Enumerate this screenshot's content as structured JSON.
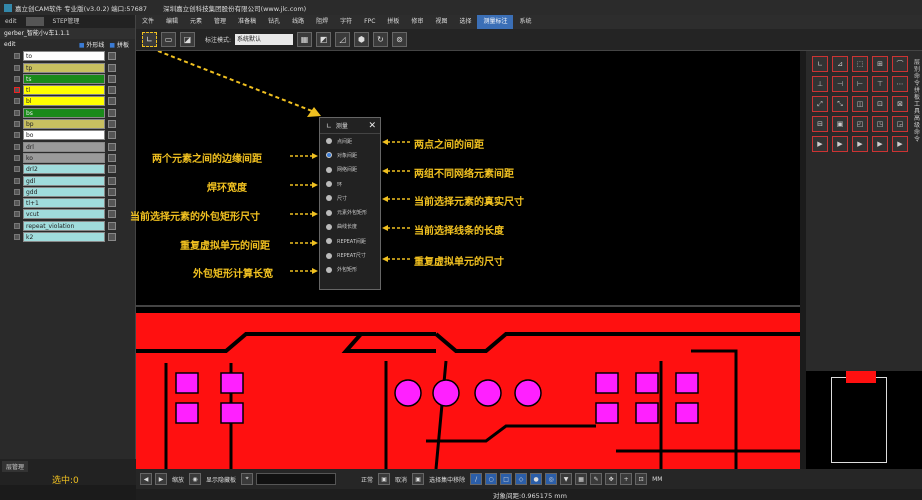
{
  "app": {
    "title": "嘉立创CAM软件 专业版(v3.0.2) 端口:57687",
    "company": "深圳嘉立创科技集团股份有限公司(www.jlc.com)"
  },
  "left_panel": {
    "tabs": [
      "edit",
      "STEP管理"
    ],
    "job": "gerber_智能小v车1.1.1",
    "step": "edit",
    "show_outline": "外形线",
    "show_panel": "拼板",
    "layers": [
      {
        "name": "to",
        "color": "#ffffff"
      },
      {
        "name": "tp",
        "color": "#c8c060"
      },
      {
        "name": "ts",
        "color": "#1a8a1a"
      },
      {
        "name": "tl",
        "color": "#ffff00",
        "active": true
      },
      {
        "name": "bl",
        "color": "#ffff00"
      },
      {
        "name": "bs",
        "color": "#1a8a1a"
      },
      {
        "name": "bp",
        "color": "#c8c060"
      },
      {
        "name": "bo",
        "color": "#ffffff"
      },
      {
        "name": "drl",
        "color": "#9a9a9a"
      },
      {
        "name": "ko",
        "color": "#9a9a9a"
      },
      {
        "name": "drl2",
        "color": "#a0dcdc"
      },
      {
        "name": "gdl",
        "color": "#a0dcdc"
      },
      {
        "name": "gdd",
        "color": "#a0dcdc"
      },
      {
        "name": "tl+1",
        "color": "#a0dcdc"
      },
      {
        "name": "vcut",
        "color": "#a0dcdc"
      },
      {
        "name": "repeat_violation",
        "color": "#a0dcdc"
      },
      {
        "name": "k2",
        "color": "#a0dcdc"
      }
    ],
    "footer_tab": "层管理",
    "selected_count": "选中:0"
  },
  "menu": [
    "文件",
    "编辑",
    "元素",
    "管理",
    "准备稿",
    "钻孔",
    "线路",
    "阻焊",
    "字符",
    "FPC",
    "拼板",
    "修审",
    "视图",
    "选择",
    "测量标注",
    "系统"
  ],
  "menu_active": "测量标注",
  "toolbar": {
    "mode_label": "标注模式:",
    "mode_value": "系统默认"
  },
  "popup": {
    "title": "测量",
    "close_glyph": "✕",
    "options": [
      "点间距",
      "对象间距",
      "网络间距",
      "环",
      "尺寸",
      "元素外包矩形",
      "曲线长度",
      "REPEAT间距",
      "REPEAT尺寸",
      "外包矩形"
    ],
    "selected_index": 1
  },
  "annotations": {
    "left": [
      "两个元素之间的边缘间距",
      "焊环宽度",
      "当前选择元素的外包矩形尺寸",
      "重复虚拟单元的间距",
      "外包矩形计算长宽"
    ],
    "right": [
      "两点之间的间距",
      "两组不同网络元素间距",
      "当前选择元素的真实尺寸",
      "当前选择线条的长度",
      "重复虚拟单元的尺寸"
    ]
  },
  "right_panel": {
    "vtabs": "层别命令 拼板工具 高级命令"
  },
  "bottom": {
    "unit": "MM",
    "mode": "正常",
    "btn_label_1": "显示隐藏板",
    "btn_label_2": "取消",
    "btn_label_3": "选择集中移除",
    "status": "对象间距:0.965175 mm",
    "zoom_label": "缩放"
  },
  "colors": {
    "accent": "#f0c020",
    "copper": "#ff1010",
    "pad": "#ff20ff",
    "menu_active": "#3b6fb6"
  }
}
